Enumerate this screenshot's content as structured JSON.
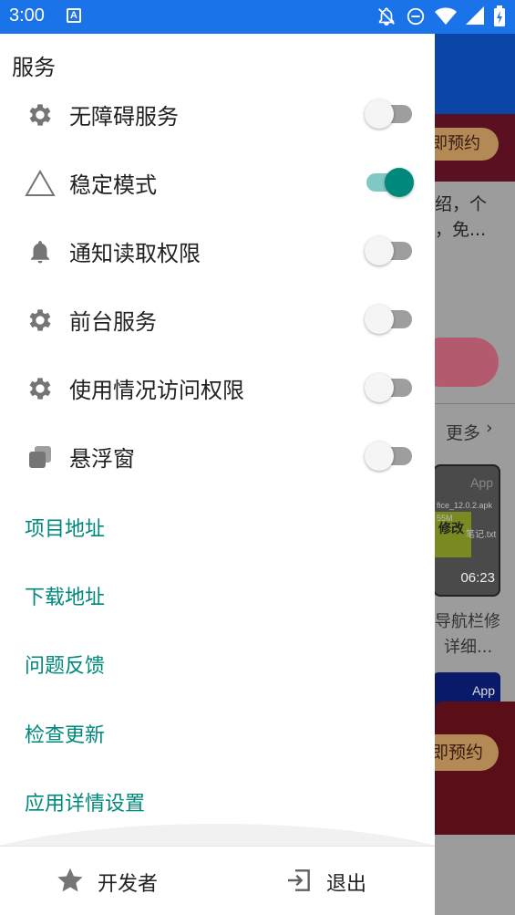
{
  "status_bar": {
    "time": "3:00",
    "app_icon_letter": "A",
    "icons": [
      "notifications-off-icon",
      "do-not-disturb-icon",
      "wifi-icon",
      "signal-icon",
      "battery-charging-icon"
    ]
  },
  "drawer": {
    "section_title": "服务",
    "services": [
      {
        "label": "无障碍服务",
        "icon": "gear-icon",
        "enabled": false
      },
      {
        "label": "稳定模式",
        "icon": "triangle-icon",
        "enabled": true
      },
      {
        "label": "通知读取权限",
        "icon": "bell-icon",
        "enabled": false
      },
      {
        "label": "前台服务",
        "icon": "gear-icon",
        "enabled": false
      },
      {
        "label": "使用情况访问权限",
        "icon": "gear-icon",
        "enabled": false
      },
      {
        "label": "悬浮窗",
        "icon": "floating-window-icon",
        "enabled": false
      }
    ],
    "links": [
      "项目地址",
      "下载地址",
      "问题反馈",
      "检查更新",
      "应用详情设置"
    ],
    "bottom": {
      "developer_label": "开发者",
      "exit_label": "退出"
    }
  },
  "background_app": {
    "reserve_button_1": "即预约",
    "desc_line_1": "绍，个",
    "desc_line_2": "，免...",
    "more_label": "更多",
    "thumb_app_tag": "App",
    "thumb_filename": "fice_12.0.2.apk",
    "thumb_size": "55M",
    "thumb_note": "笔记.txt",
    "thumb_green_text": "修改",
    "thumb_duration": "06:23",
    "video_title_1": "导航栏修",
    "video_title_2": "详细...",
    "thumb2_app_tag": "App",
    "reserve_button_2": "即预约"
  },
  "colors": {
    "status_bar": "#1a73e8",
    "accent": "#00897b",
    "switch_off_track": "#9e9e9e"
  }
}
